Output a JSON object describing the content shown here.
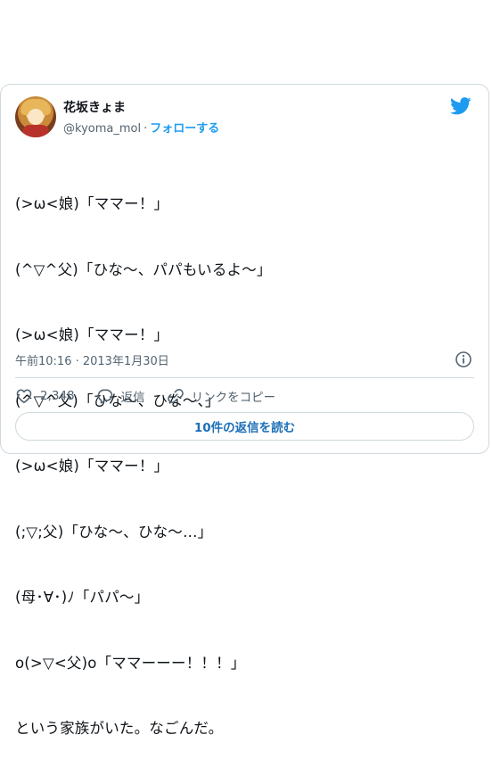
{
  "author": {
    "name": "花坂きょま",
    "handle": "@kyoma_mol",
    "separator": "·",
    "follow_label": "フォローする"
  },
  "tweet": {
    "lines": [
      "(>ω<娘)「ママー！」",
      "(^▽^父)「ひな〜、パパもいるよ〜」",
      "(>ω<娘)「ママー！」",
      "(^▽^父)「ひな〜、ひな〜、」",
      "(>ω<娘)「ママー！」",
      "(;▽;父)「ひな〜、ひな〜…」",
      "(母･∀･)ﾉ「パパ〜」",
      "o(>▽<父)o「ママーーー！！！」",
      "という家族がいた。なごんだ。"
    ],
    "timestamp": "午前10:16 · 2013年1月30日"
  },
  "actions": {
    "like_count": "2,348",
    "reply_label": "返信",
    "copy_link_label": "リンクをコピー"
  },
  "read_replies_label": "10件の返信を読む",
  "icons": {
    "bird": "twitter-bird-icon",
    "info": "info-icon",
    "heart": "heart-icon",
    "reply": "reply-bubble-icon",
    "link": "link-icon"
  },
  "colors": {
    "accent": "#1d9bf0",
    "text": "#0f1419",
    "muted": "#536471",
    "border": "#cfd9de"
  }
}
